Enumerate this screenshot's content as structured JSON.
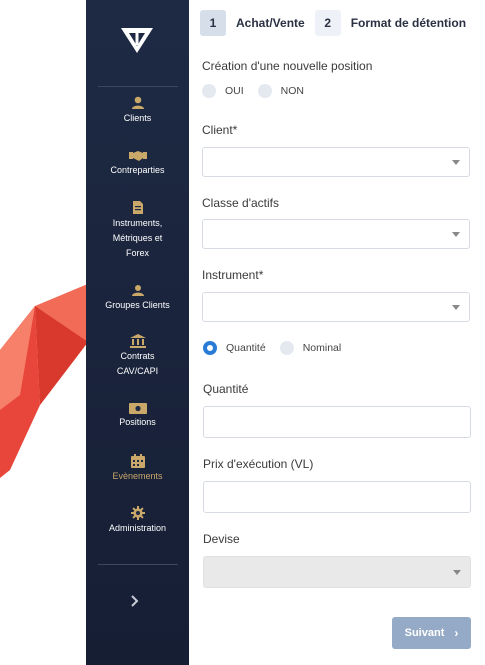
{
  "sidebar": {
    "items": [
      {
        "label": "Clients",
        "icon": "user-icon"
      },
      {
        "label": "Contreparties",
        "icon": "handshake-icon"
      },
      {
        "label": "Instruments, Métriques et Forex",
        "icon": "document-icon"
      },
      {
        "label": "Groupes Clients",
        "icon": "users-icon"
      },
      {
        "label": "Contrats CAV/CAPI",
        "icon": "bank-icon"
      },
      {
        "label": "Positions",
        "icon": "money-icon"
      },
      {
        "label": "Evènements",
        "icon": "calendar-icon"
      },
      {
        "label": "Administration",
        "icon": "gear-icon"
      }
    ],
    "collapse_icon": "chevron-right-icon"
  },
  "steps": [
    {
      "num": "1",
      "label": "Achat/Vente"
    },
    {
      "num": "2",
      "label": "Format de détention"
    }
  ],
  "form": {
    "new_position_label": "Création d'une nouvelle position",
    "oui": "OUI",
    "non": "NON",
    "client_label": "Client*",
    "asset_class_label": "Classe d'actifs",
    "instrument_label": "Instrument*",
    "quantite_option": "Quantité",
    "nominal_option": "Nominal",
    "quantity_label": "Quantité",
    "price_label": "Prix d'exécution (VL)",
    "currency_label": "Devise",
    "next_button": "Suivant"
  },
  "colors": {
    "sidebar_bg": "#1e2a44",
    "accent_gold": "#c9a86a",
    "radio_blue": "#2a7bd6",
    "button_bg": "#95aac6",
    "decoration_red": "#ef5a44"
  }
}
